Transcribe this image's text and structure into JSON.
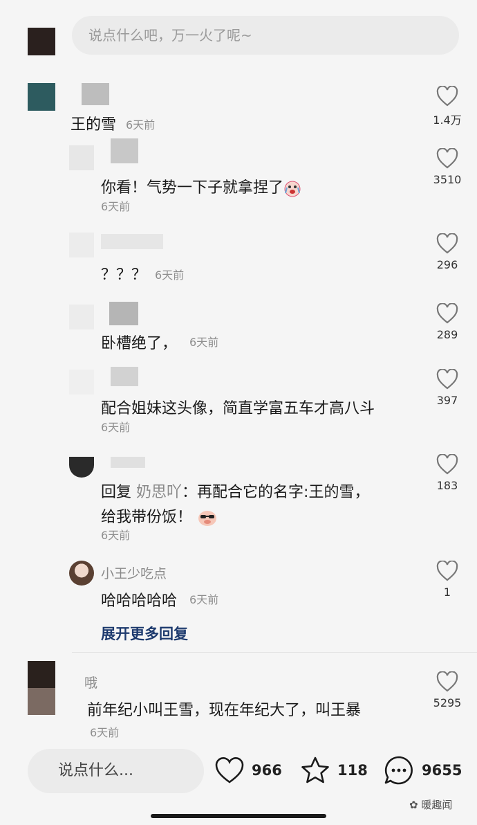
{
  "top_input": {
    "placeholder": "说点什么吧，万一火了呢~"
  },
  "comments": [
    {
      "name": "",
      "text": "王的雪",
      "time": "6天前",
      "likes": "1.4万"
    },
    {
      "name": "",
      "text": "你看！气势一下子就拿捏了",
      "time": "6天前",
      "likes": "3510",
      "emoji": "crying-face-emoji"
    },
    {
      "name": "",
      "text": "？？？",
      "time": "6天前",
      "likes": "296"
    },
    {
      "name": "",
      "text": "卧槽绝了，",
      "time": "6天前",
      "likes": "289"
    },
    {
      "name": "",
      "text": "配合姐妹这头像，简直学富五车才高八斗",
      "time": "6天前",
      "likes": "397"
    },
    {
      "name": "",
      "reply_prefix": "回复",
      "reply_to": "奶思吖",
      "text_line1": "：再配合它的名字:王的雪，",
      "text_line2": "给我带份饭！",
      "time": "6天前",
      "likes": "183",
      "emoji": "cool-pig-emoji"
    },
    {
      "name": "小王少吃点",
      "text": "哈哈哈哈哈",
      "time": "6天前",
      "likes": "1"
    },
    {
      "name": "哦",
      "text": "前年纪小叫王雪，现在年纪大了，叫王暴",
      "time": "6天前",
      "likes": "5295"
    }
  ],
  "expand_label": "展开更多回复",
  "bottom": {
    "input_placeholder": "说点什么...",
    "like_count": "966",
    "star_count": "118",
    "comment_count": "9655"
  },
  "watermark": "暖趣闻"
}
